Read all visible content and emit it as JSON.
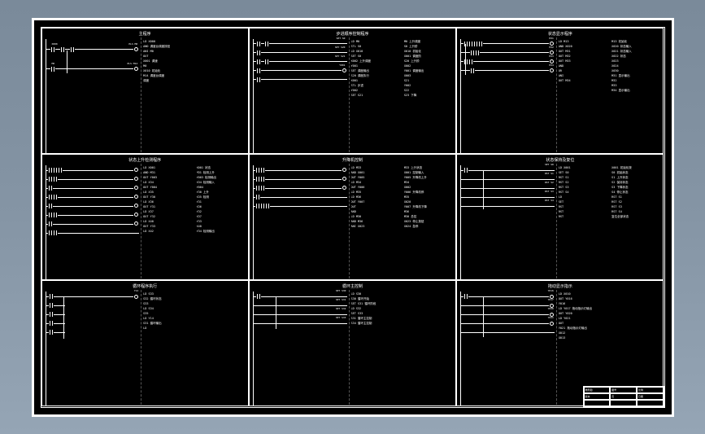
{
  "drawing": {
    "title_block": {
      "project": "梯形图",
      "sheet": "图号",
      "scale": "比例",
      "rev": "版本",
      "page": "页",
      "date": "日期"
    }
  },
  "cells": [
    {
      "title": "主程序",
      "rungs": [
        {
          "contacts": [
            "X000",
            "X001",
            "X010"
          ],
          "coil": "PLS M0"
        },
        {
          "contacts": [
            "M0"
          ],
          "coil": "PLS M14"
        }
      ],
      "notes": [
        "LD X000",
        "AND    调度台调度按钮",
        "ANI M0",
        "OUT",
        "X001    调速",
        "M0",
        "X010    初始化",
        "M14    调度台调度",
        "        调度"
      ]
    },
    {
      "title": "步进顺序控制程序",
      "rungs": [
        {
          "contacts": [
            "M0",
            "X010"
          ],
          "coil": "SET S0"
        },
        {
          "contacts": [
            "S0",
            "X001"
          ],
          "coil": "SET S20"
        },
        {
          "contacts": [
            "S20",
            "X002"
          ],
          "coil": "SET S21"
        },
        {
          "contacts": [
            "M1"
          ],
          "coil": "Y001"
        },
        {
          "contacts": [],
          "coil": ""
        }
      ],
      "notes_cols": [
        [
          "LD M0",
          "STL S0",
          "LD X010",
          "SET S0",
          "X002 上升调度",
          "Y001",
          "SET    调度输出",
          "S20    调度执行",
          "X001",
          "STL    步进",
          "Y002",
          "SET S21"
        ],
        [
          "M0 上升调度",
          "S0    上升阶",
          "X010 初始化",
          "X001 调度阶",
          "S20 上升阶",
          "X002",
          "Y001 调度输出",
          "X003",
          "S21",
          "Y002",
          "S22",
          "S23 下降"
        ]
      ]
    },
    {
      "title": "状态显示程序",
      "rungs": [
        {
          "contacts": [
            "M13",
            "X020",
            "X021",
            "X022"
          ],
          "coil": "M31"
        },
        {
          "contacts": [
            "X023",
            "X020"
          ],
          "coil": "M32"
        },
        {
          "contacts": [
            "X024",
            "X030"
          ],
          "coil": "M33"
        },
        {
          "contacts": [
            ""
          ],
          "coil": "M34"
        }
      ],
      "notes_cols": [
        [
          "LD M13",
          "AND X020",
          "OUT M31",
          "OUT M32",
          "OUT M33",
          "AND",
          "OR",
          "ANI",
          "OUT M34"
        ],
        [
          "M13    初始化",
          "X020 状态输入",
          "X021 状态输入",
          "X022 状态",
          "X023",
          "X024",
          "X030",
          "M31 显示输出",
          "M32",
          "M33",
          "M34 显示输出"
        ]
      ]
    },
    {
      "title": "状态上升检测程序",
      "rungs": [
        {
          "contacts": [
            "X001",
            "M31",
            "X030"
          ],
          "coil": "Y003"
        },
        {
          "contacts": [
            "X34",
            "M32"
          ],
          "coil": "Y004"
        },
        {
          "contacts": [
            "X35"
          ],
          "coil": "Y30"
        },
        {
          "contacts": [
            "X36",
            "X32"
          ],
          "coil": "Y31"
        },
        {
          "contacts": [
            "X37"
          ],
          "coil": "Y32"
        },
        {
          "contacts": [
            "X40",
            "M33"
          ],
          "coil": "Y33"
        },
        {
          "contacts": [
            "X42"
          ],
          "coil": "Y34"
        }
      ],
      "notes_cols": [
        [
          "LD X001",
          "AND M31",
          "OUT Y003",
          "LD X34",
          "OUT Y004",
          "LD X35",
          "OUT Y30",
          "LD X36",
          "OUT Y31",
          "LD X37",
          "OUT Y32",
          "LD X40",
          "OUT Y33",
          "LD X42"
        ],
        [
          "X001    状态",
          "M31    检测上升",
          "Y003    检测输出",
          "X34    检测输入",
          "Y004",
          "Y30    上升",
          "X35    检测",
          "Y31",
          "X36",
          "Y32",
          "X37",
          "Y33",
          "X40",
          "Y34 检测输出"
        ]
      ]
    },
    {
      "title": "升降机控制",
      "rungs": [
        {
          "contacts": [
            "M33",
            "X001"
          ],
          "coil": "Y005"
        },
        {
          "contacts": [
            "M34",
            "X002"
          ],
          "coil": "Y006"
        },
        {
          "contacts": [
            "M35",
            "X020"
          ],
          "coil": "Y007"
        },
        {
          "contacts": [
            "M36"
          ],
          "coil": ""
        },
        {
          "contacts": [
            "M30",
            "M36",
            "X023"
          ],
          "coil": ""
        }
      ],
      "notes_cols": [
        [
          "LD M33",
          "AND X001",
          "OUT Y005",
          "LD M34",
          "OUT Y006",
          "LD M35",
          "LD M36",
          "OUT Y007",
          "OUT",
          "AND",
          "LD M30",
          "AND M36",
          "ANI X023"
        ],
        [
          "M33    上升状态",
          "X001    控制输入",
          "Y005 升降机上升",
          "M34",
          "X002",
          "Y006 升降机停",
          "M35",
          "X020",
          "Y007 升降机下降",
          "M36",
          "M30    总控",
          "X023 停止按钮",
          "X024 急停"
        ]
      ]
    },
    {
      "title": "状态保持及复位",
      "rungs": [
        {
          "contacts": [
            "X001"
          ],
          "coil": "SET S0"
        },
        {
          "contacts": [
            ""
          ],
          "coil": "RST S1"
        },
        {
          "contacts": [
            ""
          ],
          "coil": "RST S2"
        },
        {
          "contacts": [
            ""
          ],
          "coil": "RST S3"
        },
        {
          "contacts": [
            ""
          ],
          "coil": "RST S4"
        }
      ],
      "notes_cols": [
        [
          "LD X001",
          "SET S0",
          "RST S1",
          "RST S2",
          "RST S3",
          "RST S4",
          "LD",
          "SET",
          "RST",
          "RST",
          "RST"
        ],
        [
          "X001 初始化按",
          "S0    初始状态",
          "S1    上升状态",
          "S2    保持状态",
          "S3    下降状态",
          "S4    停止状态",
          "RST S1",
          "RST S2",
          "RST S3",
          "RST S4",
          "复位全部状态"
        ]
      ]
    },
    {
      "title": "循环程序执行",
      "rungs": [
        {
          "contacts": [
            "S33"
          ],
          "coil": "Y14"
        },
        {
          "contacts": [
            "S32"
          ],
          "coil": ""
        },
        {
          "contacts": [
            "S33"
          ],
          "coil": ""
        },
        {
          "contacts": [
            "S34"
          ],
          "coil": ""
        },
        {
          "contacts": [
            "S35"
          ],
          "coil": ""
        }
      ],
      "notes": [
        "LD S33",
        "S32    循环状态",
        "S33",
        "LD S34",
        "S35",
        "LD Y14",
        "S31    循环输出",
        "LD"
      ]
    },
    {
      "title": "循环主控制",
      "rungs": [
        {
          "contacts": [
            "M13"
          ],
          "coil": "SET S30"
        },
        {
          "contacts": [
            ""
          ],
          "coil": "SET S31"
        },
        {
          "contacts": [
            ""
          ],
          "coil": "SET S32"
        },
        {
          "contacts": [
            ""
          ],
          "coil": "SET S33"
        }
      ],
      "notes": [
        "LD    S30",
        "S30  循环开始",
        "SET S31  循环阶段",
        "LD    S32",
        "SET S33",
        "S31  循环主控制",
        "S34  循环主控制"
      ]
    },
    {
      "title": "拖动显示指示",
      "rungs": [
        {
          "contacts": [
            "X010"
          ],
          "coil": "Y016"
        },
        {
          "contacts": [
            ""
          ],
          "coil": "Y017"
        },
        {
          "contacts": [
            ""
          ],
          "coil": "Y020"
        },
        {
          "contacts": [
            ""
          ],
          "coil": "Y021"
        },
        {
          "contacts": [
            ""
          ],
          "coil": ""
        }
      ],
      "notes": [
        "LD X010",
        "OUT Y016",
        "Y016",
        "LD Y017  拖动指示灯输出",
        "OUT Y020",
        "LD Y021",
        "OUT",
        "Y021     拖动指示灯输出",
        "X012",
        "X013"
      ]
    }
  ]
}
